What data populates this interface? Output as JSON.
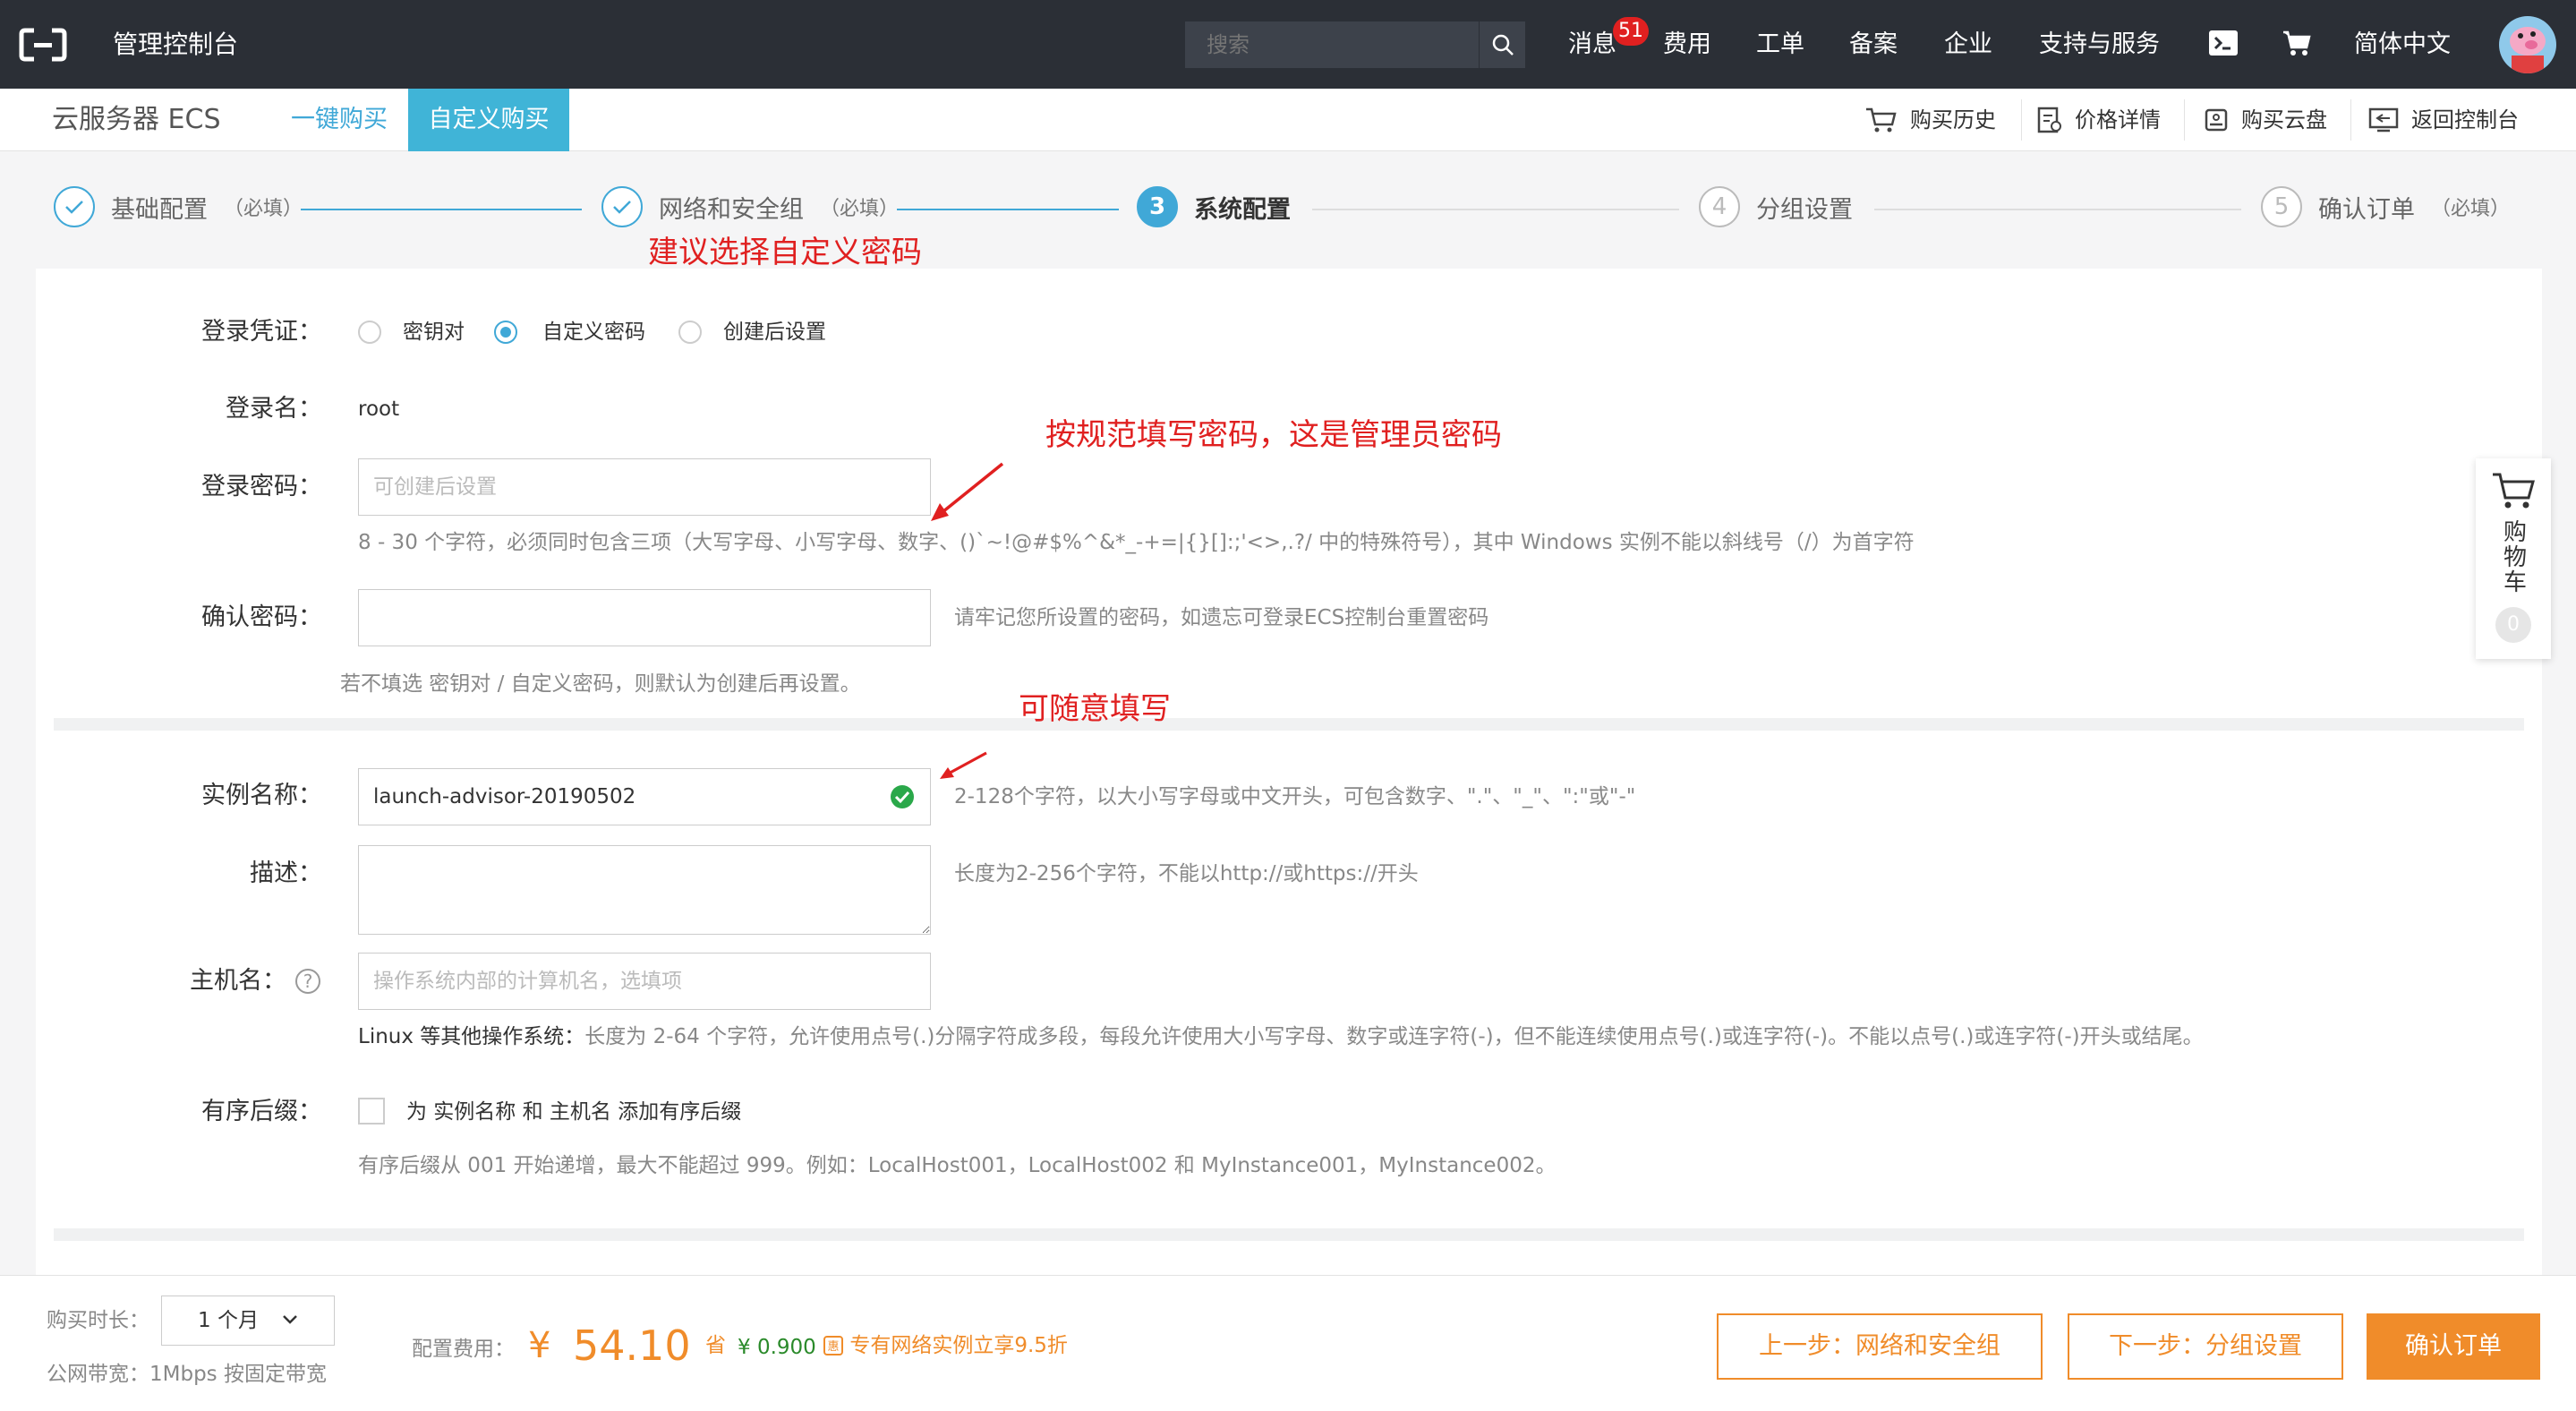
{
  "topbar": {
    "title": "管理控制台",
    "search_placeholder": "搜索",
    "messages_label": "消息",
    "messages_badge": "51",
    "nav": [
      "费用",
      "工单",
      "备案",
      "企业",
      "支持与服务"
    ],
    "language": "简体中文"
  },
  "subbar": {
    "product": "云服务器 ECS",
    "tab_quick": "一键购买",
    "tab_custom": "自定义购买",
    "links": [
      "购买历史",
      "价格详情",
      "购买云盘",
      "返回控制台"
    ]
  },
  "steps": [
    {
      "num": "",
      "label": "基础配置",
      "req": "（必填）",
      "state": "done"
    },
    {
      "num": "",
      "label": "网络和安全组",
      "req": "（必填）",
      "state": "done"
    },
    {
      "num": "3",
      "label": "系统配置",
      "req": "",
      "state": "active"
    },
    {
      "num": "4",
      "label": "分组设置",
      "req": "",
      "state": "pending"
    },
    {
      "num": "5",
      "label": "确认订单",
      "req": "（必填）",
      "state": "pending"
    }
  ],
  "annotations": {
    "custom_password": "建议选择自定义密码",
    "fill_password": "按规范填写密码，这是管理员密码",
    "fill_freely": "可随意填写"
  },
  "form": {
    "credential_label": "登录凭证：",
    "credential_options": [
      "密钥对",
      "自定义密码",
      "创建后设置"
    ],
    "credential_selected": "自定义密码",
    "login_name_label": "登录名：",
    "login_name_value": "root",
    "password_label": "登录密码：",
    "password_placeholder": "可创建后设置",
    "password_hint": "8 - 30 个字符，必须同时包含三项（大写字母、小写字母、数字、()`~!@#$%^&*_-+=|{}[]:;'<>,.?/ 中的特殊符号），其中 Windows 实例不能以斜线号（/）为首字符",
    "confirm_label": "确认密码：",
    "confirm_hint": "请牢记您所设置的密码，如遗忘可登录ECS控制台重置密码",
    "default_note": "若不填选 密钥对 / 自定义密码，则默认为创建后再设置。",
    "instance_name_label": "实例名称：",
    "instance_name_value": "launch-advisor-20190502",
    "instance_name_hint": "2-128个字符，以大小写字母或中文开头，可包含数字、\".\"、\"_\"、\":\"或\"-\"",
    "desc_label": "描述：",
    "desc_hint": "长度为2-256个字符，不能以http://或https://开头",
    "hostname_label": "主机名：",
    "hostname_placeholder": "操作系统内部的计算机名，选填项",
    "hostname_hint_bold": "Linux 等其他操作系统：",
    "hostname_hint": "长度为 2-64 个字符，允许使用点号(.)分隔字符成多段，每段允许使用大小写字母、数字或连字符(-)，但不能连续使用点号(.)或连字符(-)。不能以点号(.)或连字符(-)开头或结尾。",
    "suffix_label": "有序后缀：",
    "suffix_checkbox_label": "为 实例名称 和 主机名 添加有序后缀",
    "suffix_hint": "有序后缀从 001 开始递增，最大不能超过 999。例如：LocalHost001，LocalHost002 和 MyInstance001，MyInstance002。"
  },
  "cart": {
    "label": "购物车",
    "count": "0"
  },
  "footer": {
    "duration_label": "购买时长：",
    "duration_value": "1 个月",
    "bandwidth": "公网带宽：1Mbps 按固定带宽",
    "cost_label": "配置费用：",
    "currency": "¥",
    "price": "54.10",
    "save_label": "省",
    "save_value": "¥ 0.900",
    "promo": "专有网络实例立享9.5折",
    "btn_prev": "上一步：网络和安全组",
    "btn_next": "下一步：分组设置",
    "btn_confirm": "确认订单"
  },
  "colors": {
    "accent": "#40a8d7",
    "orange": "#f08c2a",
    "annotation": "#e02020",
    "topbar": "#2b2f36"
  }
}
